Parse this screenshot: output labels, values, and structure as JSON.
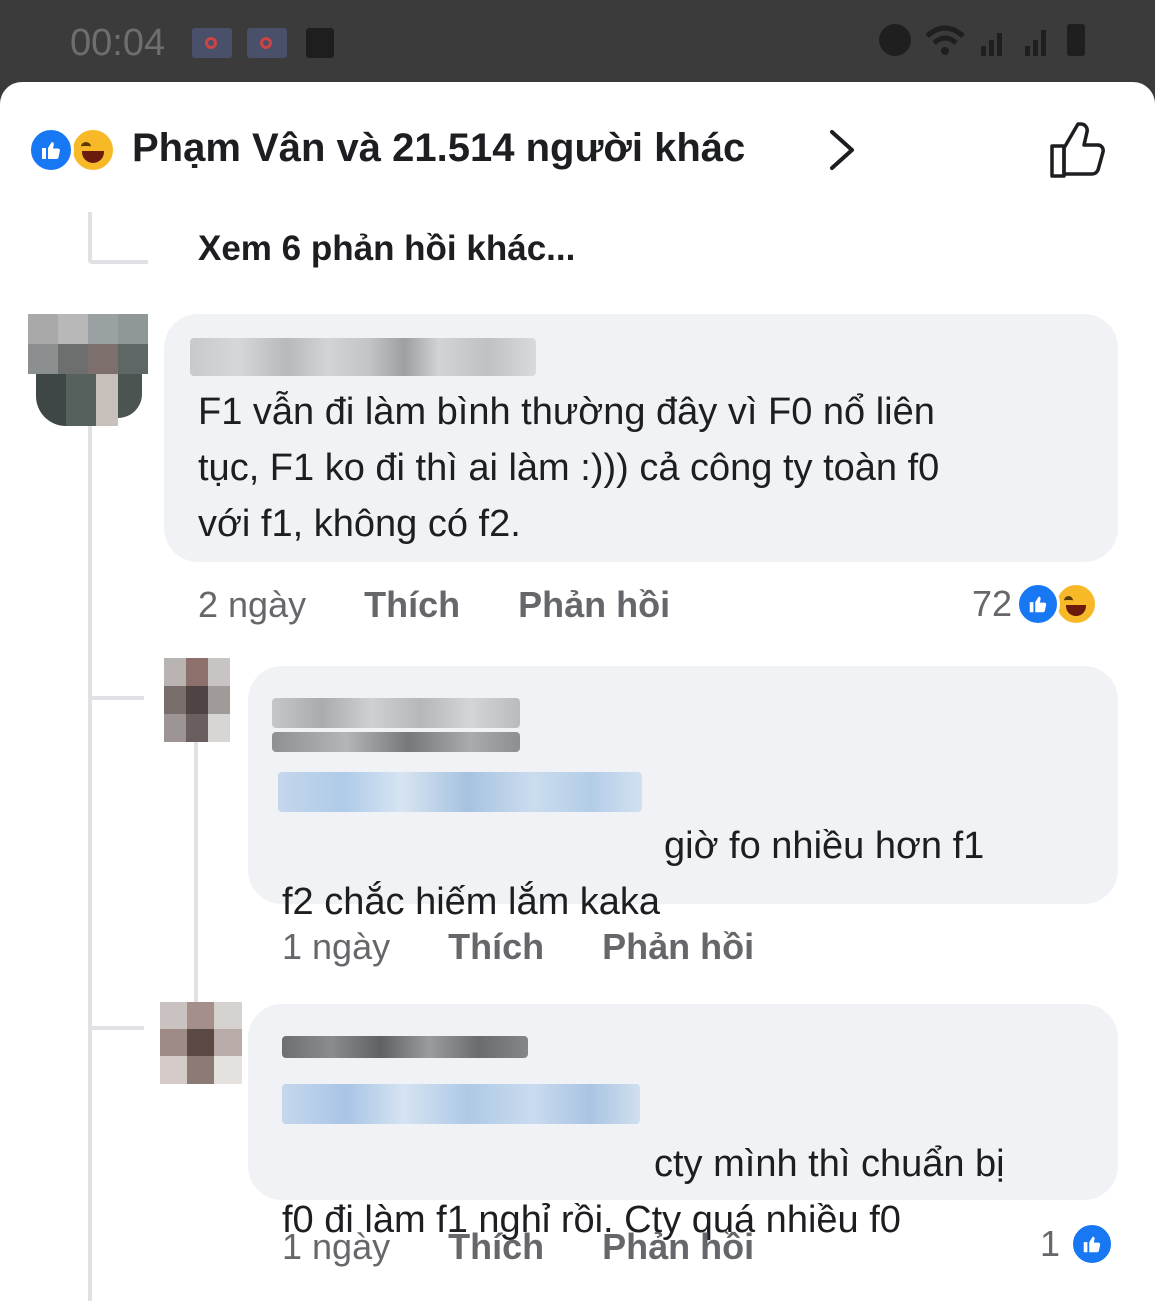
{
  "status_bar": {
    "time": "00:04",
    "icons": [
      "notification-icon",
      "notification-icon",
      "message-icon",
      "alarm-icon",
      "wifi-icon",
      "signal-icon",
      "signal-icon",
      "battery-icon"
    ]
  },
  "reactions_header": {
    "text": "Phạm Vân và 21.514 người khác",
    "icons": [
      "like-reaction-icon",
      "haha-reaction-icon",
      "chevron-right-icon",
      "like-outline-icon"
    ]
  },
  "view_more": "Xem 6 phản hồi khác...",
  "comments": [
    {
      "text": "F1 vẫn đi làm bình thường đây vì F0 nổ liên\ntục, F1 ko đi thì ai làm :))) cả công ty toàn f0\nvới f1, không có f2.",
      "time": "2 ngày",
      "like_label": "Thích",
      "reply_label": "Phản hồi",
      "reaction_count": "72",
      "reactions": [
        "like",
        "haha"
      ]
    },
    {
      "text": "giờ fo nhiều hơn f1\nf2 chắc hiếm lắm kaka",
      "time": "1 ngày",
      "like_label": "Thích",
      "reply_label": "Phản hồi"
    },
    {
      "text": "cty mình thì chuẩn bị\nf0 đi làm f1 nghỉ rồi. Cty quá nhiều f0",
      "time": "1 ngày",
      "like_label": "Thích",
      "reply_label": "Phản hồi",
      "reaction_count": "1",
      "reactions": [
        "like"
      ]
    }
  ],
  "colors": {
    "facebook_blue": "#1877f2",
    "bubble_bg": "#f0f2f5",
    "meta_text": "#65676b",
    "body_text": "#1c1e21"
  }
}
